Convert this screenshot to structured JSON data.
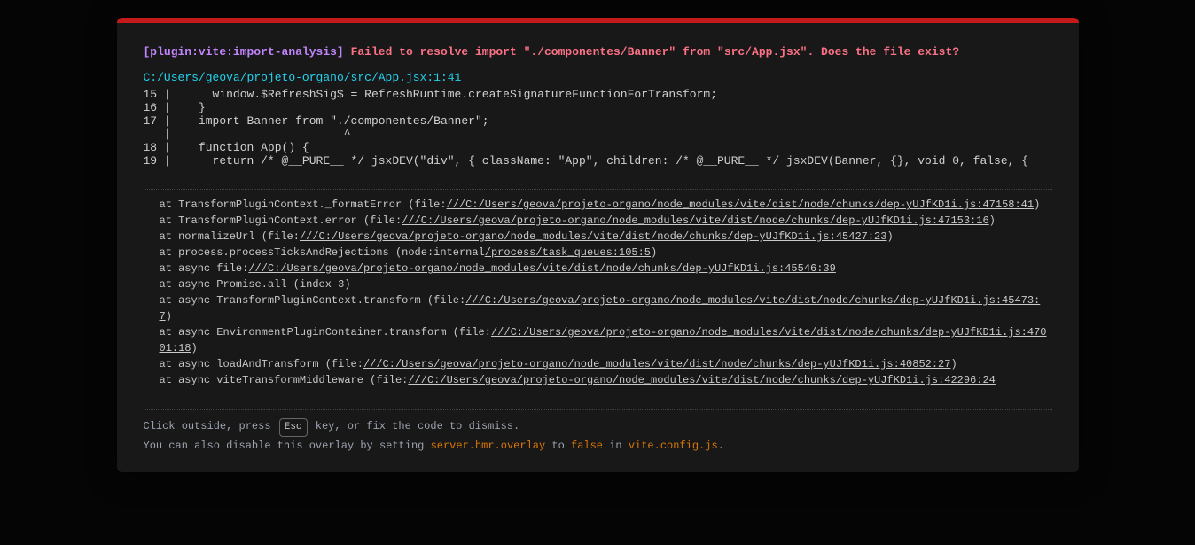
{
  "plugin_tag": "[plugin:vite:import-analysis]",
  "error_message": "Failed to resolve import \"./componentes/Banner\" from \"src/App.jsx\". Does the file exist?",
  "file": {
    "drive": "C:",
    "path": "/Users/geova/projeto-organo/src/App.jsx:1:41"
  },
  "code": {
    "lines": [
      {
        "no": "15",
        "text": "    window.$RefreshSig$ = RefreshRuntime.createSignatureFunctionForTransform;"
      },
      {
        "no": "16",
        "text": "  }"
      },
      {
        "no": "17",
        "text": "  import Banner from \"./componentes/Banner\";"
      },
      {
        "no": "  ",
        "text": "                       ^"
      },
      {
        "no": "18",
        "text": "  function App() {"
      },
      {
        "no": "19",
        "text": "    return /* @__PURE__ */ jsxDEV(\"div\", { className: \"App\", children: /* @__PURE__ */ jsxDEV(Banner, {}, void 0, false, {"
      }
    ]
  },
  "stack": [
    {
      "pre": "at TransformPluginContext._formatError (file:",
      "link": "///C:/Users/geova/projeto-organo/node_modules/vite/dist/node/chunks/dep-yUJfKD1i.js:47158:41",
      "post": ")"
    },
    {
      "pre": "at TransformPluginContext.error (file:",
      "link": "///C:/Users/geova/projeto-organo/node_modules/vite/dist/node/chunks/dep-yUJfKD1i.js:47153:16",
      "post": ")"
    },
    {
      "pre": "at normalizeUrl (file:",
      "link": "///C:/Users/geova/projeto-organo/node_modules/vite/dist/node/chunks/dep-yUJfKD1i.js:45427:23",
      "post": ")"
    },
    {
      "pre": "at process.processTicksAndRejections (node:internal",
      "link": "/process/task_queues:105:5",
      "post": ")"
    },
    {
      "pre": "at async file:",
      "link": "///C:/Users/geova/projeto-organo/node_modules/vite/dist/node/chunks/dep-yUJfKD1i.js:45546:39",
      "post": ""
    },
    {
      "pre": "at async Promise.all (index 3)",
      "link": "",
      "post": ""
    },
    {
      "pre": "at async TransformPluginContext.transform (file:",
      "link": "///C:/Users/geova/projeto-organo/node_modules/vite/dist/node/chunks/dep-yUJfKD1i.js:45473:7",
      "post": ")"
    },
    {
      "pre": "at async EnvironmentPluginContainer.transform (file:",
      "link": "///C:/Users/geova/projeto-organo/node_modules/vite/dist/node/chunks/dep-yUJfKD1i.js:47001:18",
      "post": ")"
    },
    {
      "pre": "at async loadAndTransform (file:",
      "link": "///C:/Users/geova/projeto-organo/node_modules/vite/dist/node/chunks/dep-yUJfKD1i.js:40852:27",
      "post": ")"
    },
    {
      "pre": "at async viteTransformMiddleware (file:",
      "link": "///C:/Users/geova/projeto-organo/node_modules/vite/dist/node/chunks/dep-yUJfKD1i.js:42296:24",
      "post": ""
    }
  ],
  "tip": {
    "line1_pre": "Click outside, press ",
    "esc": "Esc",
    "line1_post": " key, or fix the code to dismiss.",
    "line2_a": "You can also disable this overlay by setting ",
    "line2_b": "server.hmr.overlay",
    "line2_c": " to ",
    "line2_d": "false",
    "line2_e": " in ",
    "line2_f": "vite.config.js",
    "line2_g": "."
  }
}
